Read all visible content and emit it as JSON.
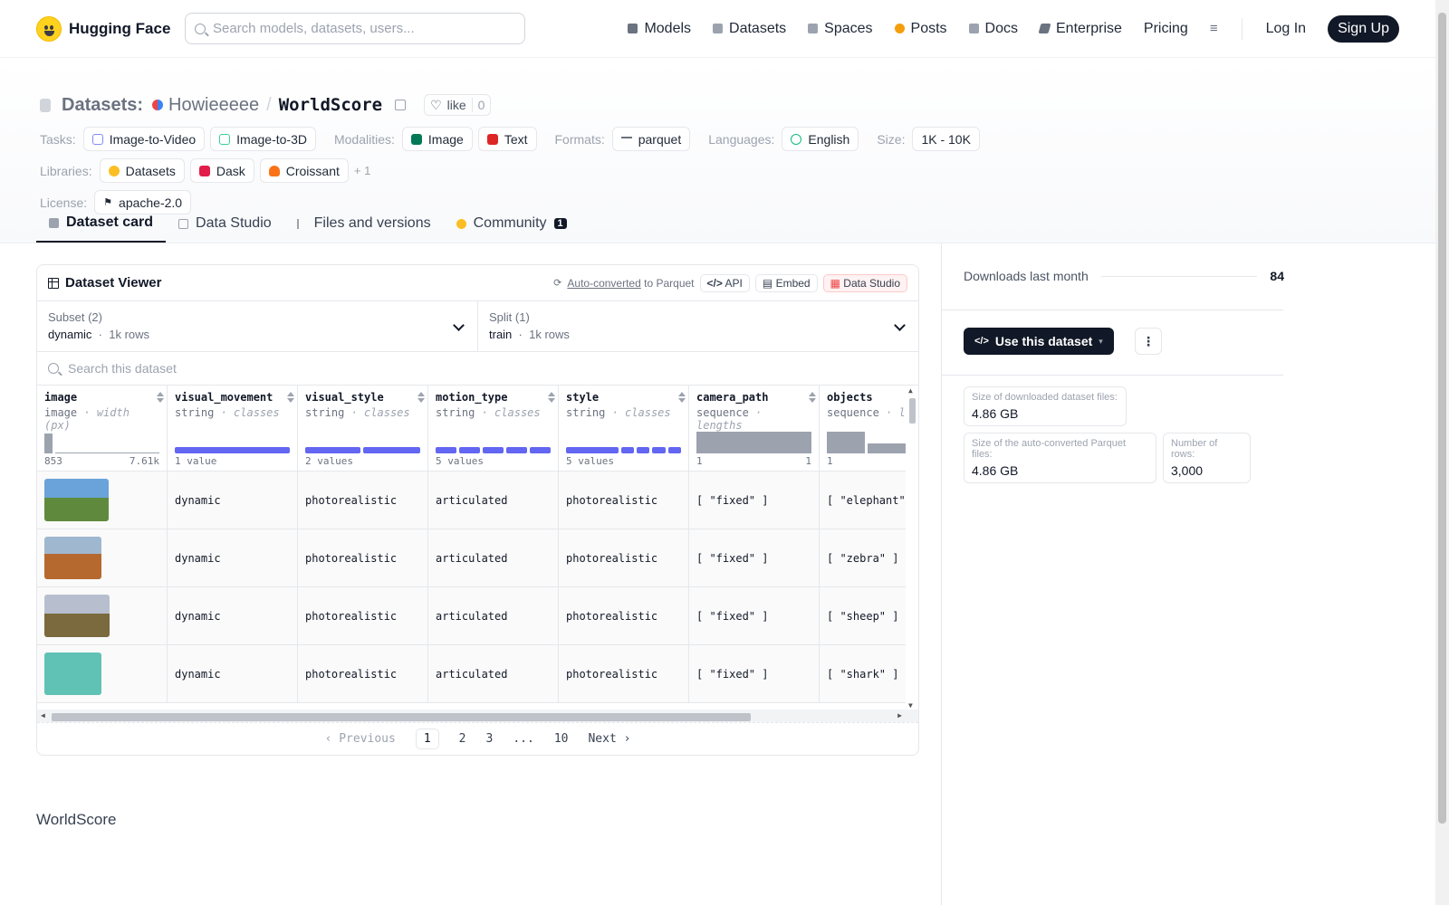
{
  "nav": {
    "brand": "Hugging Face",
    "search_placeholder": "Search models, datasets, users...",
    "links": [
      {
        "label": "Models",
        "color": "#6b7280"
      },
      {
        "label": "Datasets",
        "color": "#9ca3af"
      },
      {
        "label": "Spaces",
        "color": "#9ca3af"
      },
      {
        "label": "Posts",
        "color": "#f59e0b"
      },
      {
        "label": "Docs",
        "color": "#9ca3af"
      },
      {
        "label": "Enterprise",
        "color": "#6b7280"
      }
    ],
    "pricing": "Pricing",
    "login": "Log In",
    "signup": "Sign Up"
  },
  "header": {
    "section": "Datasets:",
    "owner": "Howieeeee",
    "name": "WorldScore",
    "like_label": "like",
    "like_count": "0"
  },
  "tags": {
    "tasks_label": "Tasks:",
    "tasks": [
      {
        "label": "Image-to-Video",
        "color": "#818cf8"
      },
      {
        "label": "Image-to-3D",
        "color": "#34d399"
      }
    ],
    "modalities_label": "Modalities:",
    "modalities": [
      {
        "label": "Image",
        "color": "#047857"
      },
      {
        "label": "Text",
        "color": "#dc2626"
      }
    ],
    "formats_label": "Formats:",
    "formats": [
      {
        "label": "parquet",
        "color": "#6b7280"
      }
    ],
    "languages_label": "Languages:",
    "languages": [
      {
        "label": "English",
        "color": "#10b981"
      }
    ],
    "size_label": "Size:",
    "size": "1K - 10K",
    "libraries_label": "Libraries:",
    "libraries": [
      {
        "label": "Datasets",
        "color": "#fbbf24"
      },
      {
        "label": "Dask",
        "color": "#e11d48"
      },
      {
        "label": "Croissant",
        "color": "#f97316"
      }
    ],
    "libraries_more": "+ 1",
    "license_label": "License:",
    "license": "apache-2.0"
  },
  "tabs": [
    {
      "label": "Dataset card",
      "active": true
    },
    {
      "label": "Data Studio"
    },
    {
      "label": "Files and versions"
    },
    {
      "label": "Community",
      "badge": "1"
    }
  ],
  "viewer": {
    "title": "Dataset Viewer",
    "auto_converted": "Auto-converted",
    "to_parquet": "to Parquet",
    "api": "API",
    "embed": "Embed",
    "data_studio": "Data Studio",
    "subset_label": "Subset (2)",
    "subset_value": "dynamic",
    "subset_rows": "1k rows",
    "split_label": "Split (1)",
    "split_value": "train",
    "split_rows": "1k rows",
    "search_placeholder": "Search this dataset",
    "columns": [
      {
        "name": "image",
        "type": "image",
        "kind": "width (px)",
        "min": "853",
        "max": "7.61k"
      },
      {
        "name": "visual_movement",
        "type": "string",
        "kind": "classes",
        "summary": "1 value",
        "segments": 1
      },
      {
        "name": "visual_style",
        "type": "string",
        "kind": "classes",
        "summary": "2 values",
        "segments": 2
      },
      {
        "name": "motion_type",
        "type": "string",
        "kind": "classes",
        "summary": "5 values",
        "segments": 5
      },
      {
        "name": "style",
        "type": "string",
        "kind": "classes",
        "summary": "5 values",
        "segments": 5
      },
      {
        "name": "camera_path",
        "type": "sequence",
        "kind": "lengths",
        "min": "1",
        "max": "1"
      },
      {
        "name": "objects",
        "type": "sequence",
        "kind": "le",
        "min": "1",
        "max": ""
      }
    ],
    "rows": [
      {
        "thumb": "elephant",
        "visual_movement": "dynamic",
        "visual_style": "photorealistic",
        "motion_type": "articulated",
        "style": "photorealistic",
        "camera_path": "[ \"fixed\" ]",
        "objects": "[ \"elephant\" ]"
      },
      {
        "thumb": "zebra",
        "visual_movement": "dynamic",
        "visual_style": "photorealistic",
        "motion_type": "articulated",
        "style": "photorealistic",
        "camera_path": "[ \"fixed\" ]",
        "objects": "[ \"zebra\" ]"
      },
      {
        "thumb": "sheep",
        "visual_movement": "dynamic",
        "visual_style": "photorealistic",
        "motion_type": "articulated",
        "style": "photorealistic",
        "camera_path": "[ \"fixed\" ]",
        "objects": "[ \"sheep\" ]"
      },
      {
        "thumb": "shark",
        "visual_movement": "dynamic",
        "visual_style": "photorealistic",
        "motion_type": "articulated",
        "style": "photorealistic",
        "camera_path": "[ \"fixed\" ]",
        "objects": "[ \"shark\" ]"
      }
    ],
    "pager": {
      "prev": "Previous",
      "pages": [
        "1",
        "2",
        "3",
        "...",
        "10"
      ],
      "current": "1",
      "next": "Next"
    }
  },
  "readme_title": "WorldScore",
  "sidebar": {
    "downloads_label": "Downloads last month",
    "downloads": "84",
    "use_button": "Use this dataset",
    "stats": [
      {
        "label": "Size of downloaded dataset files:",
        "value": "4.86 GB"
      },
      {
        "label": "Size of the auto-converted Parquet files:",
        "value": "4.86 GB"
      },
      {
        "label": "Number of rows:",
        "value": "3,000"
      }
    ]
  }
}
